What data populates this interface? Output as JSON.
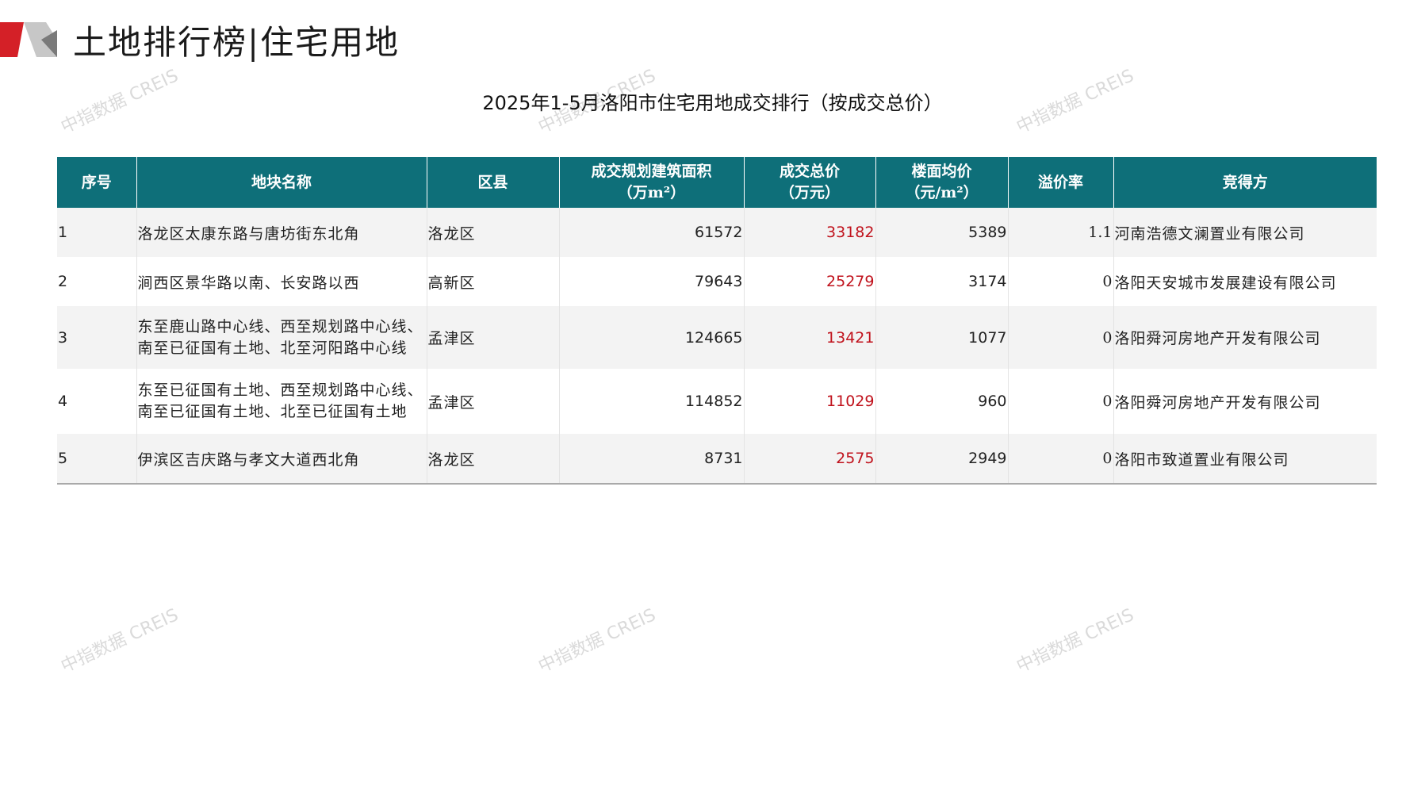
{
  "header": {
    "title": "土地排行榜|住宅用地"
  },
  "table_title": "2025年1-5月洛阳市住宅用地成交排行（按成交总价）",
  "watermark": "中指数据 CREIS",
  "colors": {
    "header_bg": "#0e6f79",
    "accent_red": "#c0121c",
    "logo_red": "#d42027",
    "logo_gray": "#7a7a7a"
  },
  "columns": [
    {
      "line1": "序号",
      "line2": ""
    },
    {
      "line1": "地块名称",
      "line2": ""
    },
    {
      "line1": "区县",
      "line2": ""
    },
    {
      "line1": "成交规划建筑面积",
      "line2": "（万m²）"
    },
    {
      "line1": "成交总价",
      "line2": "（万元）"
    },
    {
      "line1": "楼面均价",
      "line2": "（元/m²）"
    },
    {
      "line1": "溢价率",
      "line2": ""
    },
    {
      "line1": "竞得方",
      "line2": ""
    }
  ],
  "rows": [
    {
      "no": "1",
      "name": "洛龙区太康东路与唐坊街东北角",
      "district": "洛龙区",
      "area": "61572",
      "total": "33182",
      "unit_price": "5389",
      "premium": "1.1",
      "winner": "河南浩德文澜置业有限公司"
    },
    {
      "no": "2",
      "name": "涧西区景华路以南、长安路以西",
      "district": "高新区",
      "area": "79643",
      "total": "25279",
      "unit_price": "3174",
      "premium": "0",
      "winner": "洛阳天安城市发展建设有限公司"
    },
    {
      "no": "3",
      "name": "东至鹿山路中心线、西至规划路中心线、南至已征国有土地、北至河阳路中心线",
      "district": "孟津区",
      "area": "124665",
      "total": "13421",
      "unit_price": "1077",
      "premium": "0",
      "winner": "洛阳舜河房地产开发有限公司"
    },
    {
      "no": "4",
      "name": "东至已征国有土地、西至规划路中心线、南至已征国有土地、北至已征国有土地",
      "district": "孟津区",
      "area": "114852",
      "total": "11029",
      "unit_price": "960",
      "premium": "0",
      "winner": "洛阳舜河房地产开发有限公司"
    },
    {
      "no": "5",
      "name": "伊滨区吉庆路与孝文大道西北角",
      "district": "洛龙区",
      "area": "8731",
      "total": "2575",
      "unit_price": "2949",
      "premium": "0",
      "winner": "洛阳市致道置业有限公司"
    }
  ]
}
